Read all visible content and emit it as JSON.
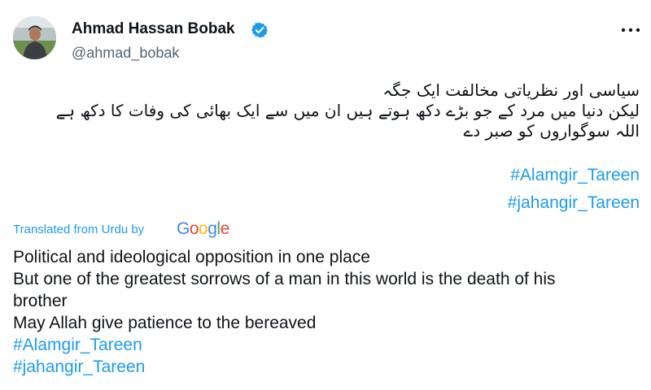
{
  "author": {
    "display_name": "Ahmad Hassan Bobak",
    "handle": "@ahmad_bobak",
    "verified": true
  },
  "icons": {
    "verified": "verified-badge-icon",
    "more": "more-options-icon"
  },
  "colors": {
    "link": "#1d9bf0",
    "text": "#0f1419",
    "secondary": "#536471"
  },
  "original_text": {
    "language": "Urdu",
    "lines": [
      "سیاسی اور نظریاتی مخالفت ایک جگہ",
      "لیکن دنیا میں مرد کے جو بڑے دکھ ہوتے ہیں ان میں سے ایک بھائی کی وفات کا دکھ ہے",
      "اللہ سوگواروں کو صبر دے"
    ],
    "hashtags": [
      "#Alamgir_Tareen",
      "#jahangir_Tareen"
    ]
  },
  "translation": {
    "label": "Translated from Urdu by",
    "provider": "Google",
    "lines": [
      "Political and ideological opposition in one place",
      "But one of the greatest sorrows of a man in this world is the death of his",
      "brother",
      "May Allah give patience to the bereaved"
    ],
    "hashtags": [
      "#Alamgir_Tareen",
      "#jahangir_Tareen"
    ]
  }
}
